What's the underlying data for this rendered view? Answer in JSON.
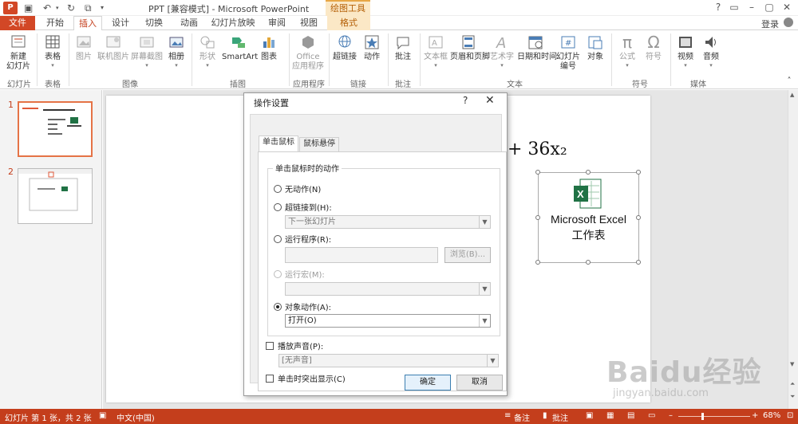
{
  "window": {
    "title": "PPT [兼容模式] - Microsoft PowerPoint",
    "contextual_tab_header": "绘图工具",
    "help": "?",
    "login": "登录"
  },
  "tabs": [
    "文件",
    "开始",
    "插入",
    "设计",
    "切换",
    "动画",
    "幻灯片放映",
    "审阅",
    "视图",
    "格式"
  ],
  "active_tab": "插入",
  "ribbon": {
    "new_slide": "新建\n幻灯片",
    "new_slide_l1": "新建",
    "new_slide_l2": "幻灯片",
    "table": "表格",
    "picture": "图片",
    "online_picture": "联机图片",
    "screenshot": "屏幕截图",
    "album": "相册",
    "shapes": "形状",
    "smartart": "SmartArt",
    "chart": "图表",
    "office_apps_l1": "Office",
    "office_apps_l2": "应用程序",
    "hyperlink": "超链接",
    "action": "动作",
    "comment": "批注",
    "textbox": "文本框",
    "header_footer": "页眉和页脚",
    "wordart": "艺术字",
    "datetime": "日期和时间",
    "slide_number_l1": "幻灯片",
    "slide_number_l2": "编号",
    "object": "对象",
    "equation": "公式",
    "symbol": "符号",
    "video": "视频",
    "audio": "音频",
    "groups": {
      "slides": "幻灯片",
      "tables": "表格",
      "images": "图像",
      "illustrations": "插图",
      "apps": "应用程序",
      "links": "链接",
      "comments": "批注",
      "text": "文本",
      "symbols": "符号",
      "media": "媒体"
    }
  },
  "thumbnails": [
    "1",
    "2"
  ],
  "slide": {
    "formula": "+ 36x₂",
    "excel_label1": "Microsoft Excel",
    "excel_label2": "工作表"
  },
  "dialog": {
    "title": "操作设置",
    "help": "?",
    "close": "✕",
    "tab_click": "单击鼠标",
    "tab_hover": "鼠标悬停",
    "group_title": "单击鼠标时的动作",
    "opt_none": "无动作(N)",
    "opt_hyperlink": "超链接到(H):",
    "hyperlink_value": "下一张幻灯片",
    "opt_run_program": "运行程序(R):",
    "browse": "浏览(B)...",
    "opt_run_macro": "运行宏(M):",
    "opt_object_action": "对象动作(A):",
    "object_action_value": "打开(O)",
    "play_sound": "播放声音(P):",
    "sound_value": "[无声音]",
    "highlight_click": "单击时突出显示(C)",
    "ok": "确定",
    "cancel": "取消",
    "selected_option": "对象动作"
  },
  "statusbar": {
    "slide_info": "幻灯片 第 1 张，共 2 张",
    "language": "中文(中国)",
    "notes": "备注",
    "comments": "批注",
    "zoom": "68%"
  },
  "watermark": {
    "big": "Baidu经验",
    "small": "jingyan.baidu.com"
  },
  "colors": {
    "accent": "#c43e1c",
    "file_tab": "#d24726",
    "contextual": "#fbe8c6"
  }
}
